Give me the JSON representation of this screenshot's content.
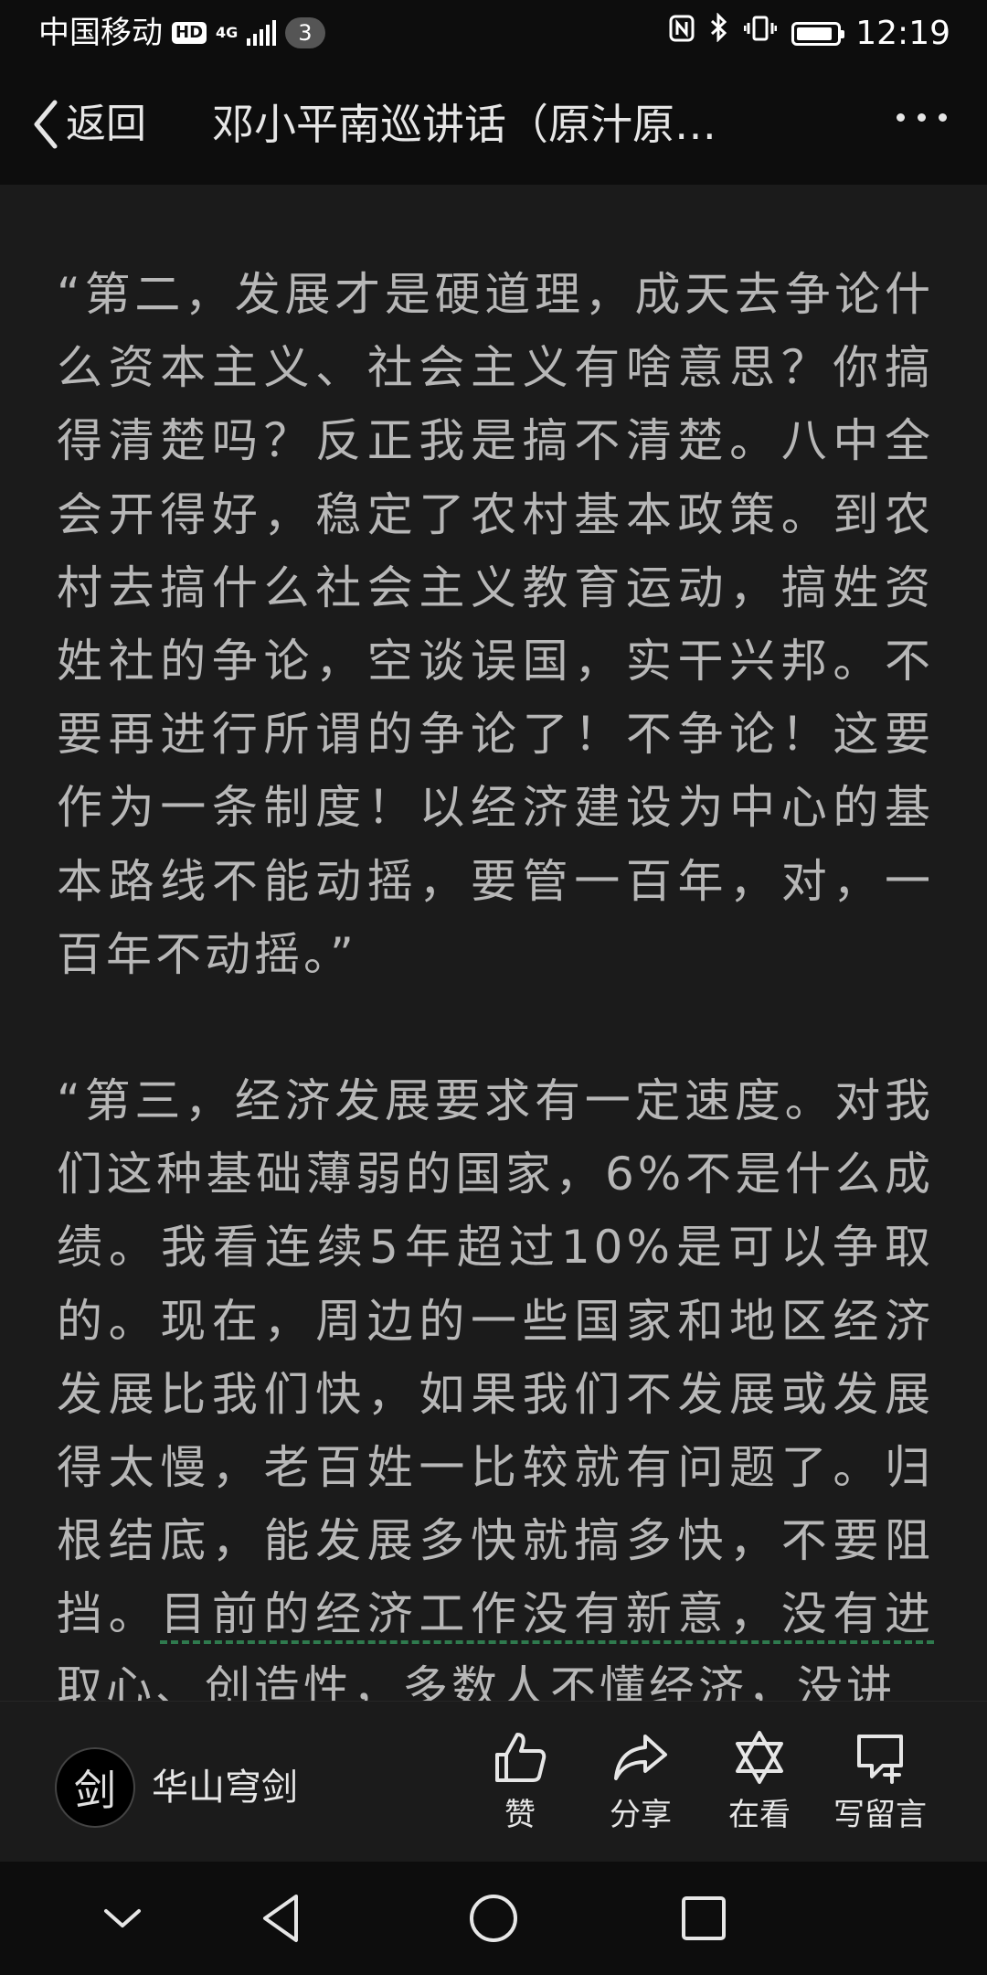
{
  "status_bar": {
    "carrier": "中国移动",
    "hd": "HD",
    "network": "4G",
    "notification_count": "3",
    "time": "12:19",
    "battery_level": 0.9
  },
  "nav": {
    "back_label": "返回",
    "title": "邓小平南巡讲话（原汁原…"
  },
  "article": {
    "p1": "“第二，发展才是硬道理，成天去争论什么资本主义、社会主义有啥意思？你搞得清楚吗？反正我是搞不清楚。八中全会开得好，稳定了农村基本政策。到农村去搞什么社会主义教育运动，搞姓资姓社的争论，空谈误国，实干兴邦。不要再进行所谓的争论了！不争论！这要作为一条制度！以经济建设为中心的基本路线不能动摇，要管一百年，对，一百年不动摇。”",
    "p2_a": "“第三，经济发展要求有一定速度。对我们这种基础薄弱的国家，6%不是什么成绩。我看连续5年超过10%是可以争取的。现在，周边的一些国家和地区经济发展比我们快，如果我们不发展或发展得太慢，老百姓一比较就有问题了。归根结底，能发展多快就搞多快，不要阻挡。",
    "p2_b": "目前的经济工作没有新意，没有进",
    "p2_c": "取心、创造性，多数人不懂经济，没讲"
  },
  "footer": {
    "author": "华山穹剑",
    "avatar_glyph": "剑",
    "like": "赞",
    "share": "分享",
    "view": "在看",
    "comment": "写留言"
  },
  "colors": {
    "background": "#1b1b1b",
    "bar": "#0d0d0d",
    "text": "#b7b7b7",
    "underline": "#2f7a4e"
  }
}
